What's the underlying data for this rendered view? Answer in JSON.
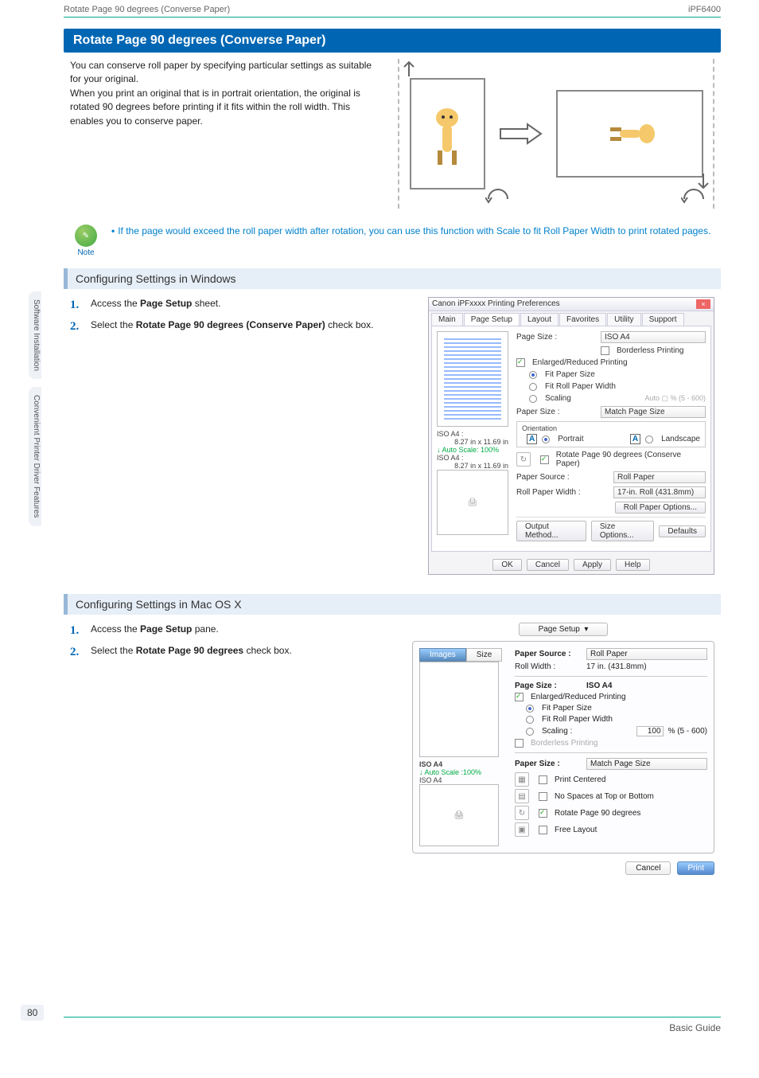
{
  "header": {
    "left": "Rotate Page 90 degrees (Converse Paper)",
    "right": "iPF6400"
  },
  "title": "Rotate Page 90 degrees (Converse Paper)",
  "intro_p1": "You can conserve roll paper by specifying particular settings as suitable for your original.",
  "intro_p2": "When you print an original that is in portrait orientation, the original is rotated 90 degrees before printing if it fits within the roll width. This enables you to conserve paper.",
  "note": {
    "label": "Note",
    "text": "If the page would exceed the roll paper width after rotation, you can use this function with Scale to fit Roll Paper Width to print rotated pages."
  },
  "win_section_title": "Configuring Settings in Windows",
  "win_steps": {
    "s1_a": "Access the ",
    "s1_b": "Page Setup",
    "s1_c": " sheet.",
    "s2_a": "Select the ",
    "s2_b": "Rotate Page 90 degrees (Conserve Paper)",
    "s2_c": " check box."
  },
  "mac_section_title": "Configuring Settings in Mac OS X",
  "mac_steps": {
    "s1_a": "Access the ",
    "s1_b": "Page Setup",
    "s1_c": " pane.",
    "s2_a": "Select the ",
    "s2_b": "Rotate Page 90 degrees",
    "s2_c": " check box."
  },
  "win_mock": {
    "title": "Canon iPFxxxx Printing Preferences",
    "tabs": [
      "Main",
      "Page Setup",
      "Layout",
      "Favorites",
      "Utility",
      "Support"
    ],
    "page_size_lbl": "Page Size :",
    "page_size_val": "ISO A4",
    "borderless": "Borderless Printing",
    "enlarged": "Enlarged/Reduced Printing",
    "fit_paper": "Fit Paper Size",
    "fit_roll": "Fit Roll Paper Width",
    "scaling": "Scaling",
    "scaling_hint": "Auto",
    "scaling_range": "% (5 - 600)",
    "paper_size_lbl": "Paper Size :",
    "paper_size_val": "Match Page Size",
    "orientation_lbl": "Orientation",
    "portrait": "Portrait",
    "landscape": "Landscape",
    "rotate_chk": "Rotate Page 90 degrees (Conserve Paper)",
    "paper_source_lbl": "Paper Source :",
    "paper_source_val": "Roll Paper",
    "roll_width_lbl": "Roll Paper Width :",
    "roll_width_val": "17-in. Roll (431.8mm)",
    "roll_opts": "Roll Paper Options...",
    "output_method": "Output Method...",
    "size_options": "Size Options...",
    "defaults": "Defaults",
    "ok": "OK",
    "cancel": "Cancel",
    "apply": "Apply",
    "help": "Help",
    "preview1_a": "ISO A4 :",
    "preview1_b": "8.27 in x 11.69 in",
    "preview1_c": "Auto Scale: 100%",
    "preview2_a": "ISO A4 :",
    "preview2_b": "8.27 in x 11.69 in"
  },
  "mac_mock": {
    "top_sel": "Page Setup",
    "tabs": [
      "Images",
      "Size"
    ],
    "paper_source_lbl": "Paper Source :",
    "paper_source_val": "Roll Paper",
    "roll_width_lbl": "Roll Width :",
    "roll_width_val": "17 in. (431.8mm)",
    "page_size_lbl": "Page Size :",
    "page_size_val": "ISO A4",
    "enlarged": "Enlarged/Reduced Printing",
    "fit_paper": "Fit Paper Size",
    "fit_roll": "Fit Roll Paper Width",
    "scaling": "Scaling :",
    "scaling_val": "100",
    "scaling_range": "% (5 - 600)",
    "borderless": "Borderless Printing",
    "paper_size_lbl": "Paper Size :",
    "paper_size_val": "Match Page Size",
    "print_centered": "Print Centered",
    "no_spaces": "No Spaces at Top or Bottom",
    "rotate": "Rotate Page 90 degrees",
    "free_layout": "Free Layout",
    "cancel": "Cancel",
    "print": "Print",
    "side_a": "ISO A4",
    "side_b": "Auto Scale :100%",
    "side_c": "ISO A4"
  },
  "side_tabs": [
    "Software Installation",
    "Convenient Printer Driver Features"
  ],
  "page_num": "80",
  "footer": "Basic Guide"
}
